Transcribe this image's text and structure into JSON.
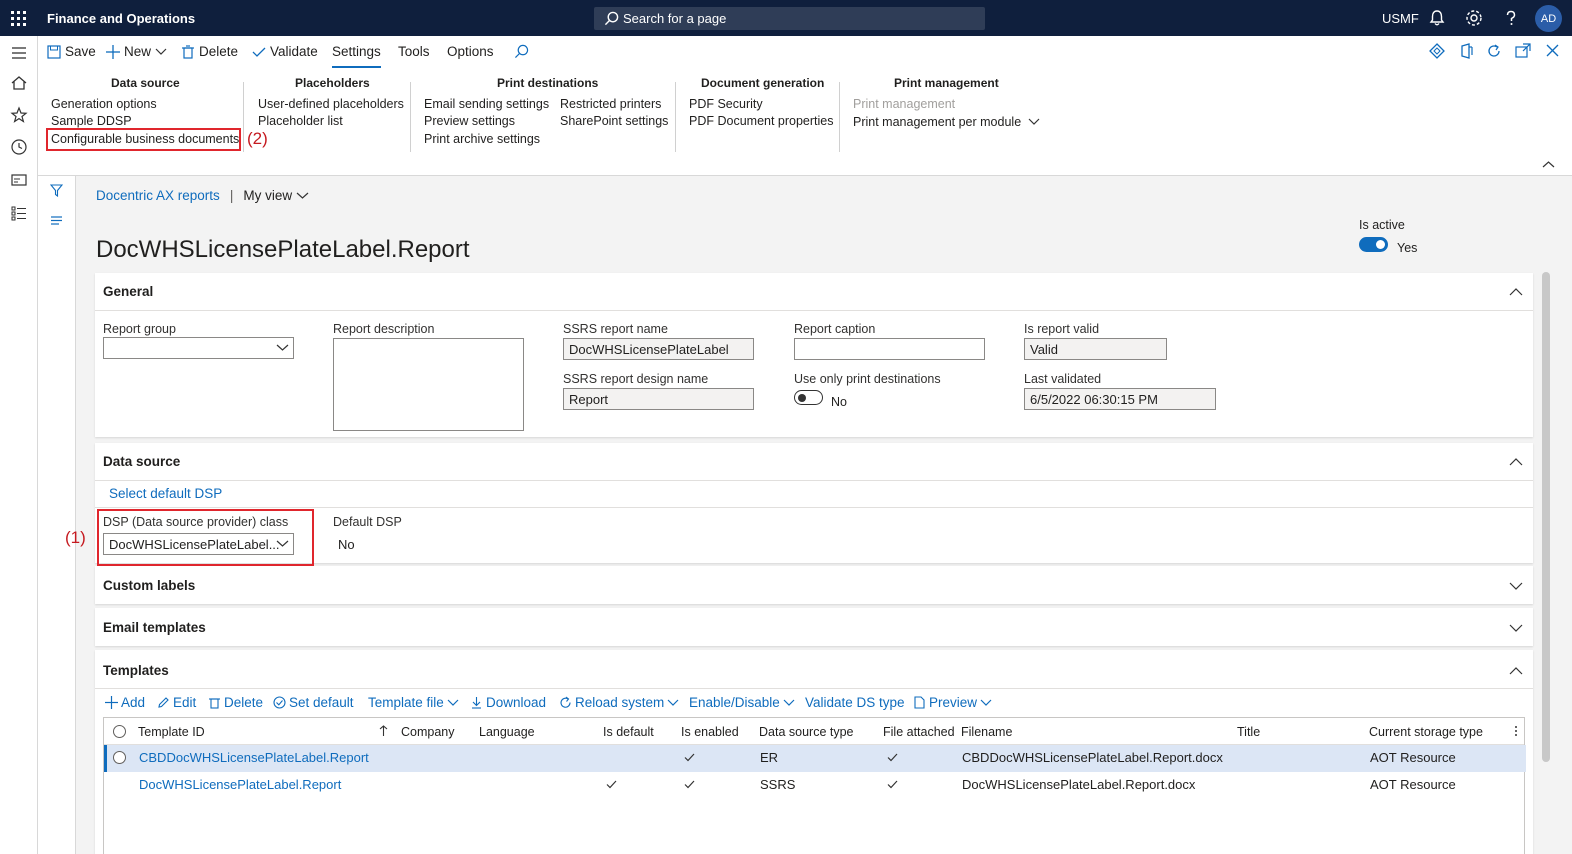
{
  "app": {
    "title": "Finance and Operations",
    "search_placeholder": "Search for a page",
    "company": "USMF",
    "avatar_initials": "AD"
  },
  "actions": {
    "save": "Save",
    "new": "New",
    "delete": "Delete",
    "validate": "Validate",
    "tabs": [
      "Settings",
      "Tools",
      "Options"
    ]
  },
  "ribbon": {
    "data_source": {
      "title": "Data source",
      "items": [
        "Generation options",
        "Sample DDSP",
        "Configurable business documents"
      ]
    },
    "placeholders": {
      "title": "Placeholders",
      "items": [
        "User-defined placeholders",
        "Placeholder list"
      ]
    },
    "print_destinations": {
      "title": "Print destinations",
      "items": [
        "Email sending settings",
        "Preview settings",
        "Print archive settings",
        "Restricted printers",
        "SharePoint settings"
      ]
    },
    "document_generation": {
      "title": "Document generation",
      "items": [
        "PDF Security",
        "PDF Document properties"
      ]
    },
    "print_management": {
      "title": "Print management",
      "items": [
        "Print management",
        "Print management per module"
      ]
    }
  },
  "annotations": {
    "one": "(1)",
    "two": "(2)"
  },
  "breadcrumb": {
    "module": "Docentric AX reports",
    "view": "My view"
  },
  "page_title": "DocWHSLicensePlateLabel.Report",
  "is_active": {
    "label": "Is active",
    "value": "Yes"
  },
  "general": {
    "title": "General",
    "report_group_label": "Report group",
    "report_group_value": "",
    "report_description_label": "Report description",
    "ssrs_report_name_label": "SSRS report name",
    "ssrs_report_name_value": "DocWHSLicensePlateLabel",
    "ssrs_design_label": "SSRS report design name",
    "ssrs_design_value": "Report",
    "report_caption_label": "Report caption",
    "report_caption_value": "",
    "use_only_print_dest_label": "Use only print destinations",
    "use_only_print_dest_value": "No",
    "is_valid_label": "Is report valid",
    "is_valid_value": "Valid",
    "last_validated_label": "Last validated",
    "last_validated_value": "6/5/2022 06:30:15 PM"
  },
  "data_source": {
    "title": "Data source",
    "select_default": "Select default DSP",
    "dsp_class_label": "DSP (Data source provider) class",
    "dsp_class_value": "DocWHSLicensePlateLabel...",
    "default_dsp_label": "Default DSP",
    "default_dsp_value": "No"
  },
  "custom_labels": {
    "title": "Custom labels"
  },
  "email_templates": {
    "title": "Email templates"
  },
  "templates": {
    "title": "Templates",
    "toolbar": {
      "add": "Add",
      "edit": "Edit",
      "delete": "Delete",
      "set_default": "Set default",
      "template_file": "Template file",
      "download": "Download",
      "reload": "Reload system",
      "enable": "Enable/Disable",
      "validate_ds": "Validate DS type",
      "preview": "Preview"
    },
    "columns": [
      "Template ID",
      "Company",
      "Language",
      "Is default",
      "Is enabled",
      "Data source type",
      "File attached",
      "Filename",
      "Title",
      "Current storage type"
    ],
    "rows": [
      {
        "id": "CBDDocWHSLicensePlateLabel.Report",
        "company": "",
        "language": "",
        "is_default": false,
        "is_enabled": true,
        "ds_type": "ER",
        "file_attached": true,
        "filename": "CBDDocWHSLicensePlateLabel.Report.docx",
        "title": "",
        "storage": "AOT Resource"
      },
      {
        "id": "DocWHSLicensePlateLabel.Report",
        "company": "",
        "language": "",
        "is_default": true,
        "is_enabled": true,
        "ds_type": "SSRS",
        "file_attached": true,
        "filename": "DocWHSLicensePlateLabel.Report.docx",
        "title": "",
        "storage": "AOT Resource"
      }
    ]
  },
  "colors": {
    "topbar": "#0f1f3d",
    "accent": "#0f6cbd",
    "annotation": "#e0262d"
  }
}
